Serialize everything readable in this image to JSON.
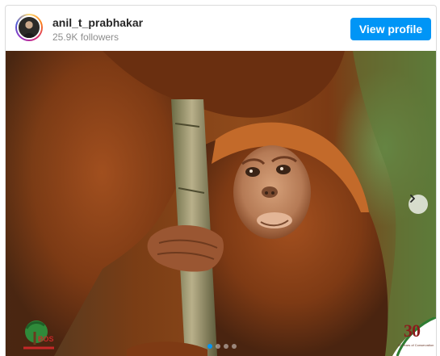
{
  "profile": {
    "username": "anil_t_prabhakar",
    "followers": "25.9K followers",
    "view_profile_label": "View profile"
  },
  "post": {
    "photo_subject": "orangutan-photo",
    "carousel": {
      "slides": 4,
      "active_index": 0
    },
    "watermark_left": "BOS",
    "watermark_right_number": "30",
    "watermark_right_caption": "30 Years of Conservation"
  },
  "colors": {
    "accent": "#0095f6",
    "text_primary": "#262626",
    "text_secondary": "#8e8e8e",
    "border": "#dbdbdb"
  },
  "icons": [
    "avatar",
    "chevron-right-icon",
    "bos-logo",
    "anniversary-badge"
  ]
}
